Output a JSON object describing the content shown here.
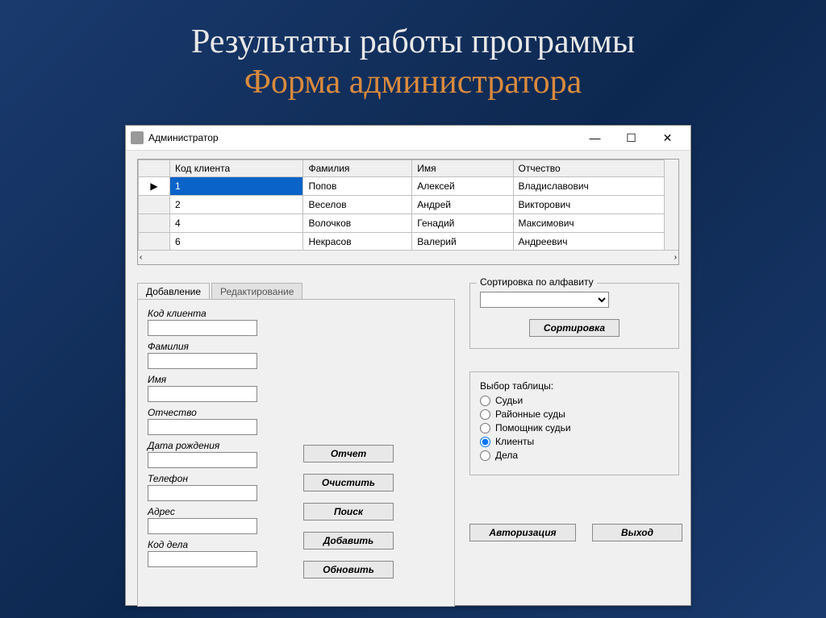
{
  "slide": {
    "title1": "Результаты работы программы",
    "title2": "Форма администратора"
  },
  "window": {
    "title": "Администратор"
  },
  "grid": {
    "headers": [
      "Код клиента",
      "Фамилия",
      "Имя",
      "Отчество"
    ],
    "rows": [
      {
        "code": "1",
        "last": "Попов",
        "first": "Алексей",
        "mid": "Владиславович"
      },
      {
        "code": "2",
        "last": "Веселов",
        "first": "Андрей",
        "mid": "Викторович"
      },
      {
        "code": "4",
        "last": "Волочков",
        "first": "Генадий",
        "mid": "Максимович"
      },
      {
        "code": "6",
        "last": "Некрасов",
        "first": "Валерий",
        "mid": "Андреевич"
      }
    ]
  },
  "tabs": {
    "add": "Добавление",
    "edit": "Редактирование"
  },
  "form": {
    "code": "Код клиента",
    "last": "Фамилия",
    "first": "Имя",
    "mid": "Отчество",
    "dob": "Дата рождения",
    "phone": "Телефон",
    "addr": "Адрес",
    "case": "Код дела"
  },
  "buttons": {
    "report": "Отчет",
    "clear": "Очистить",
    "search": "Поиск",
    "add": "Добавить",
    "update": "Обновить",
    "sort": "Сортировка",
    "auth": "Авторизация",
    "exit": "Выход"
  },
  "sort": {
    "group": "Сортировка по алфавиту"
  },
  "tables": {
    "group": "Выбор таблицы:",
    "options": [
      "Судьи",
      "Районные суды",
      "Помощник судьи",
      "Клиенты",
      "Дела"
    ],
    "selected": "Клиенты"
  }
}
